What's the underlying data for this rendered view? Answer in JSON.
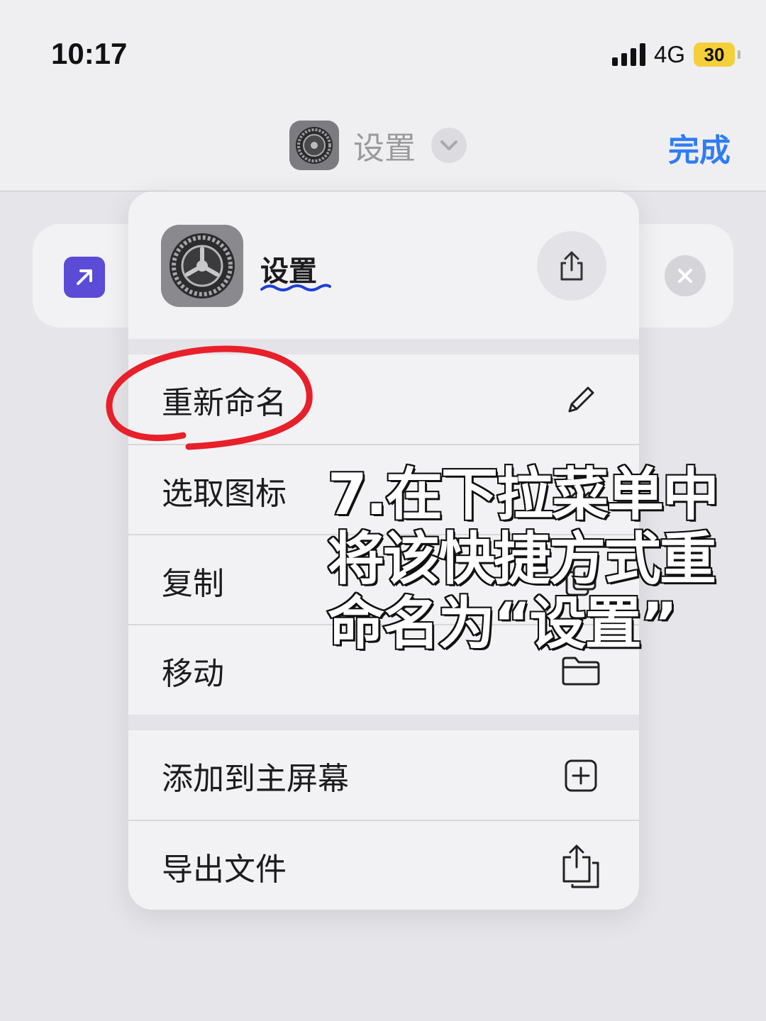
{
  "status_bar": {
    "time": "10:17",
    "network": "4G",
    "battery": "30"
  },
  "nav": {
    "title": "设置",
    "done_label": "完成"
  },
  "menu": {
    "header_title": "设置",
    "items": [
      {
        "label": "重新命名",
        "icon": "pencil-icon"
      },
      {
        "label": "选取图标",
        "icon": "photo-icon"
      },
      {
        "label": "复制",
        "icon": "duplicate-icon"
      },
      {
        "label": "移动",
        "icon": "folder-icon"
      },
      {
        "label": "添加到主屏幕",
        "icon": "plus-square-icon"
      },
      {
        "label": "导出文件",
        "icon": "export-icon"
      }
    ]
  },
  "caption": "7.在下拉菜单中\n将该快捷方式重\n命名为“设置”",
  "colors": {
    "accent": "#2f7cf6",
    "annotation": "#e8202a",
    "shortcut_icon": "#5b4bd6"
  }
}
